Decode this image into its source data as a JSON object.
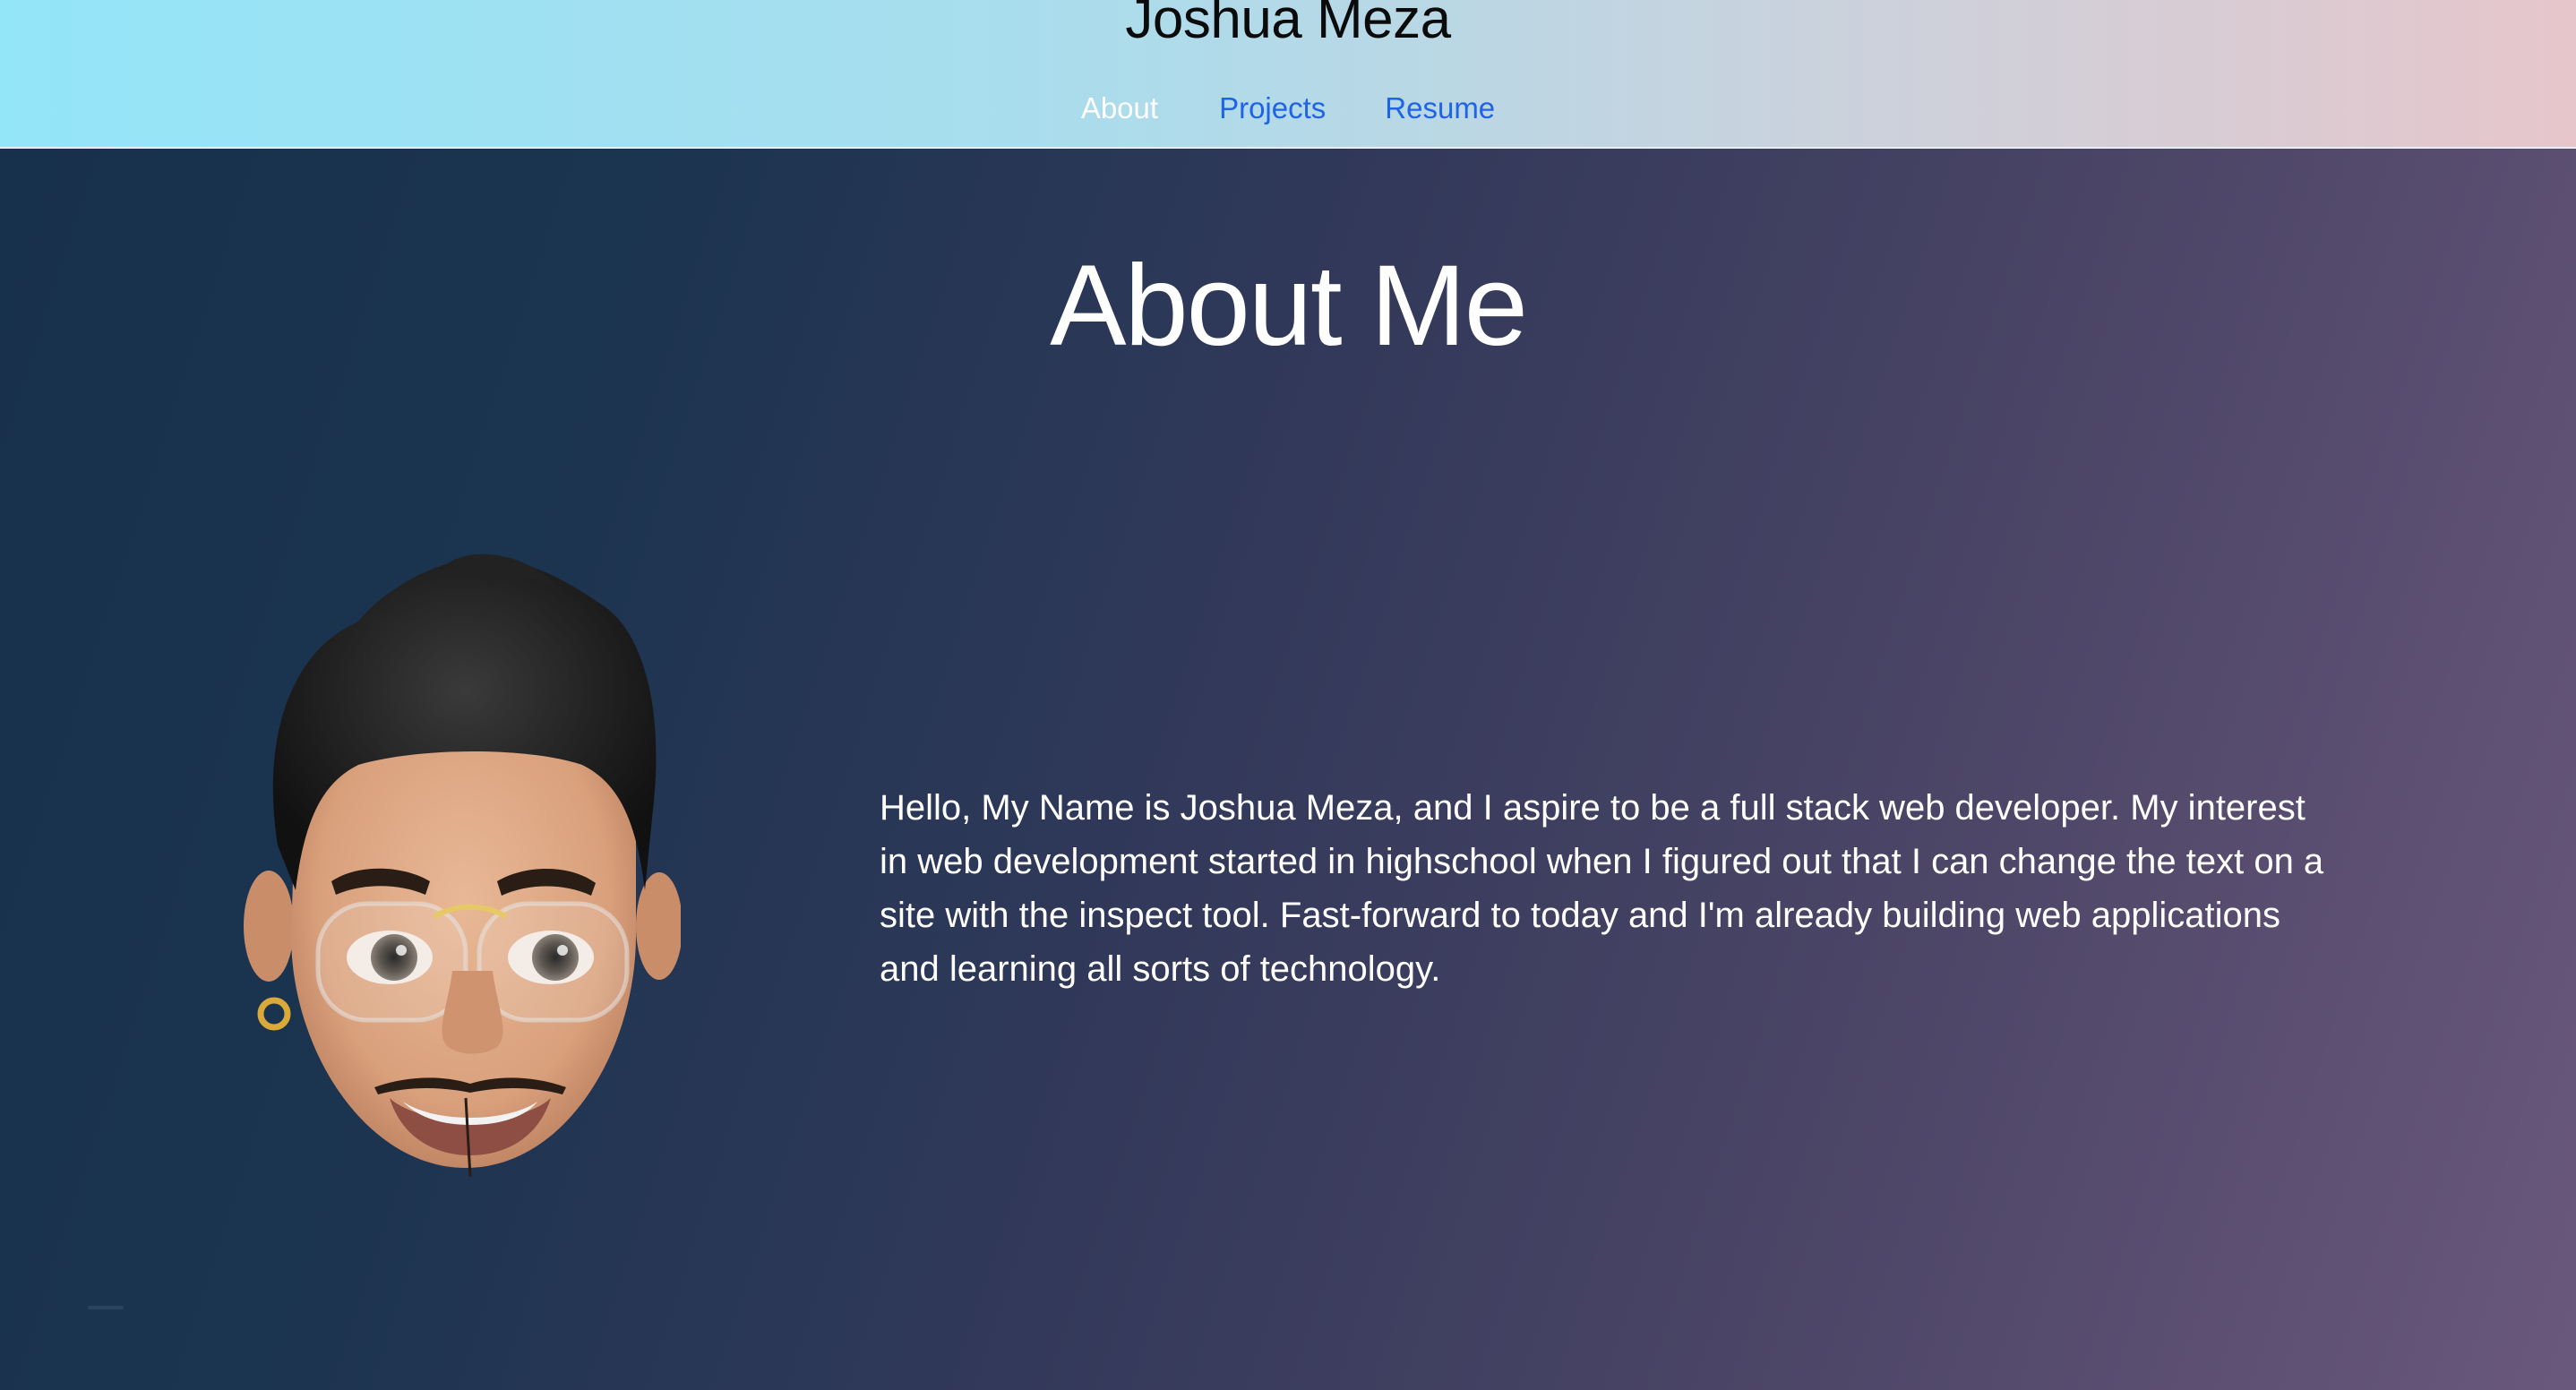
{
  "header": {
    "title": "Joshua Meza",
    "nav": {
      "about": "About",
      "projects": "Projects",
      "resume": "Resume"
    },
    "active_item": "About",
    "link_color": "#1f63e6"
  },
  "main": {
    "heading": "About Me",
    "avatar_icon": "memoji-avatar",
    "bio": "Hello, My Name is Joshua Meza, and I aspire to be a full stack web developer. My interest in web development started in highschool when I figured out that I can change the text on a site with the inspect tool. Fast-forward to today and I'm already building web applications and learning all sorts of technology."
  }
}
